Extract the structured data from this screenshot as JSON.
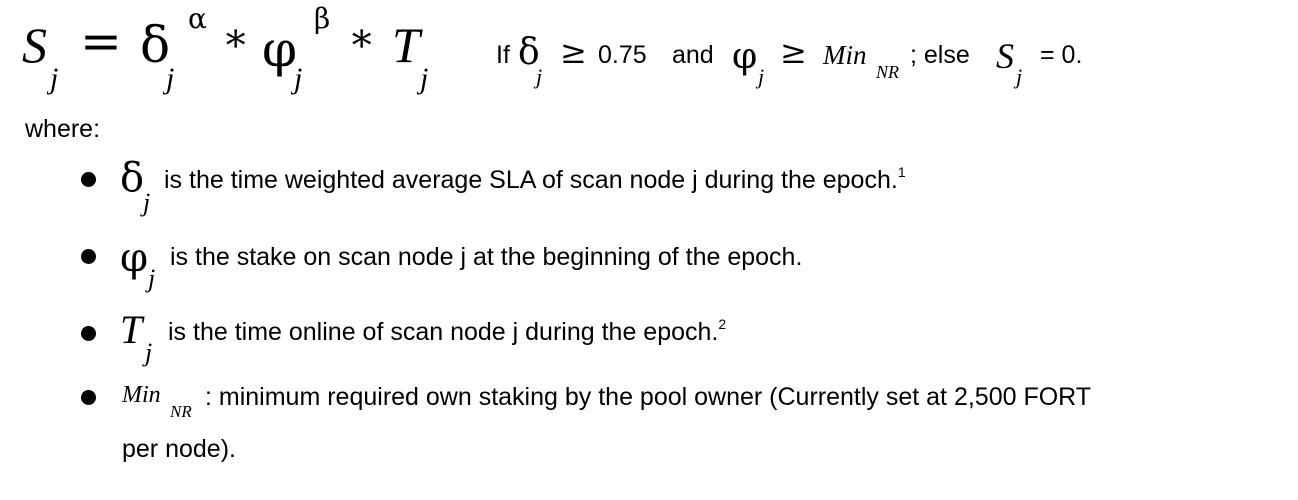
{
  "formula": {
    "lhs": "S",
    "lhs_sub": "j",
    "equals": "=",
    "term1": "δ",
    "term1_sub": "j",
    "term1_sup": "α",
    "op1": "∗",
    "term2": "φ",
    "term2_sub": "j",
    "term2_sup": "β",
    "op2": "∗",
    "term3": "T",
    "term3_sub": "j"
  },
  "condition": {
    "if": "If",
    "delta": "δ",
    "delta_sub": "j",
    "geq1": "≥",
    "threshold": "0.75",
    "and": "and",
    "phi": "φ",
    "phi_sub": "j",
    "geq2": "≥",
    "min": "Min",
    "min_sub": "NR",
    "else": "; else",
    "s": "S",
    "s_sub": "j",
    "result": "= 0."
  },
  "where_label": "where:",
  "definitions": [
    {
      "symbol": "δ",
      "sub": "j",
      "text": "is the time weighted average SLA of scan node j during the epoch.",
      "footnote": "1"
    },
    {
      "symbol": "φ",
      "sub": "j",
      "text": "is the  stake on scan node j at the beginning of the epoch.",
      "footnote": ""
    },
    {
      "symbol": "T",
      "sub": "j",
      "text": "is the time online of scan node j during the epoch.",
      "footnote": "2"
    },
    {
      "symbol": "Min",
      "sub": "NR",
      "text": ": minimum required own staking by the pool owner (Currently set at 2,500 FORT",
      "continuation": "per node).",
      "footnote": ""
    }
  ]
}
